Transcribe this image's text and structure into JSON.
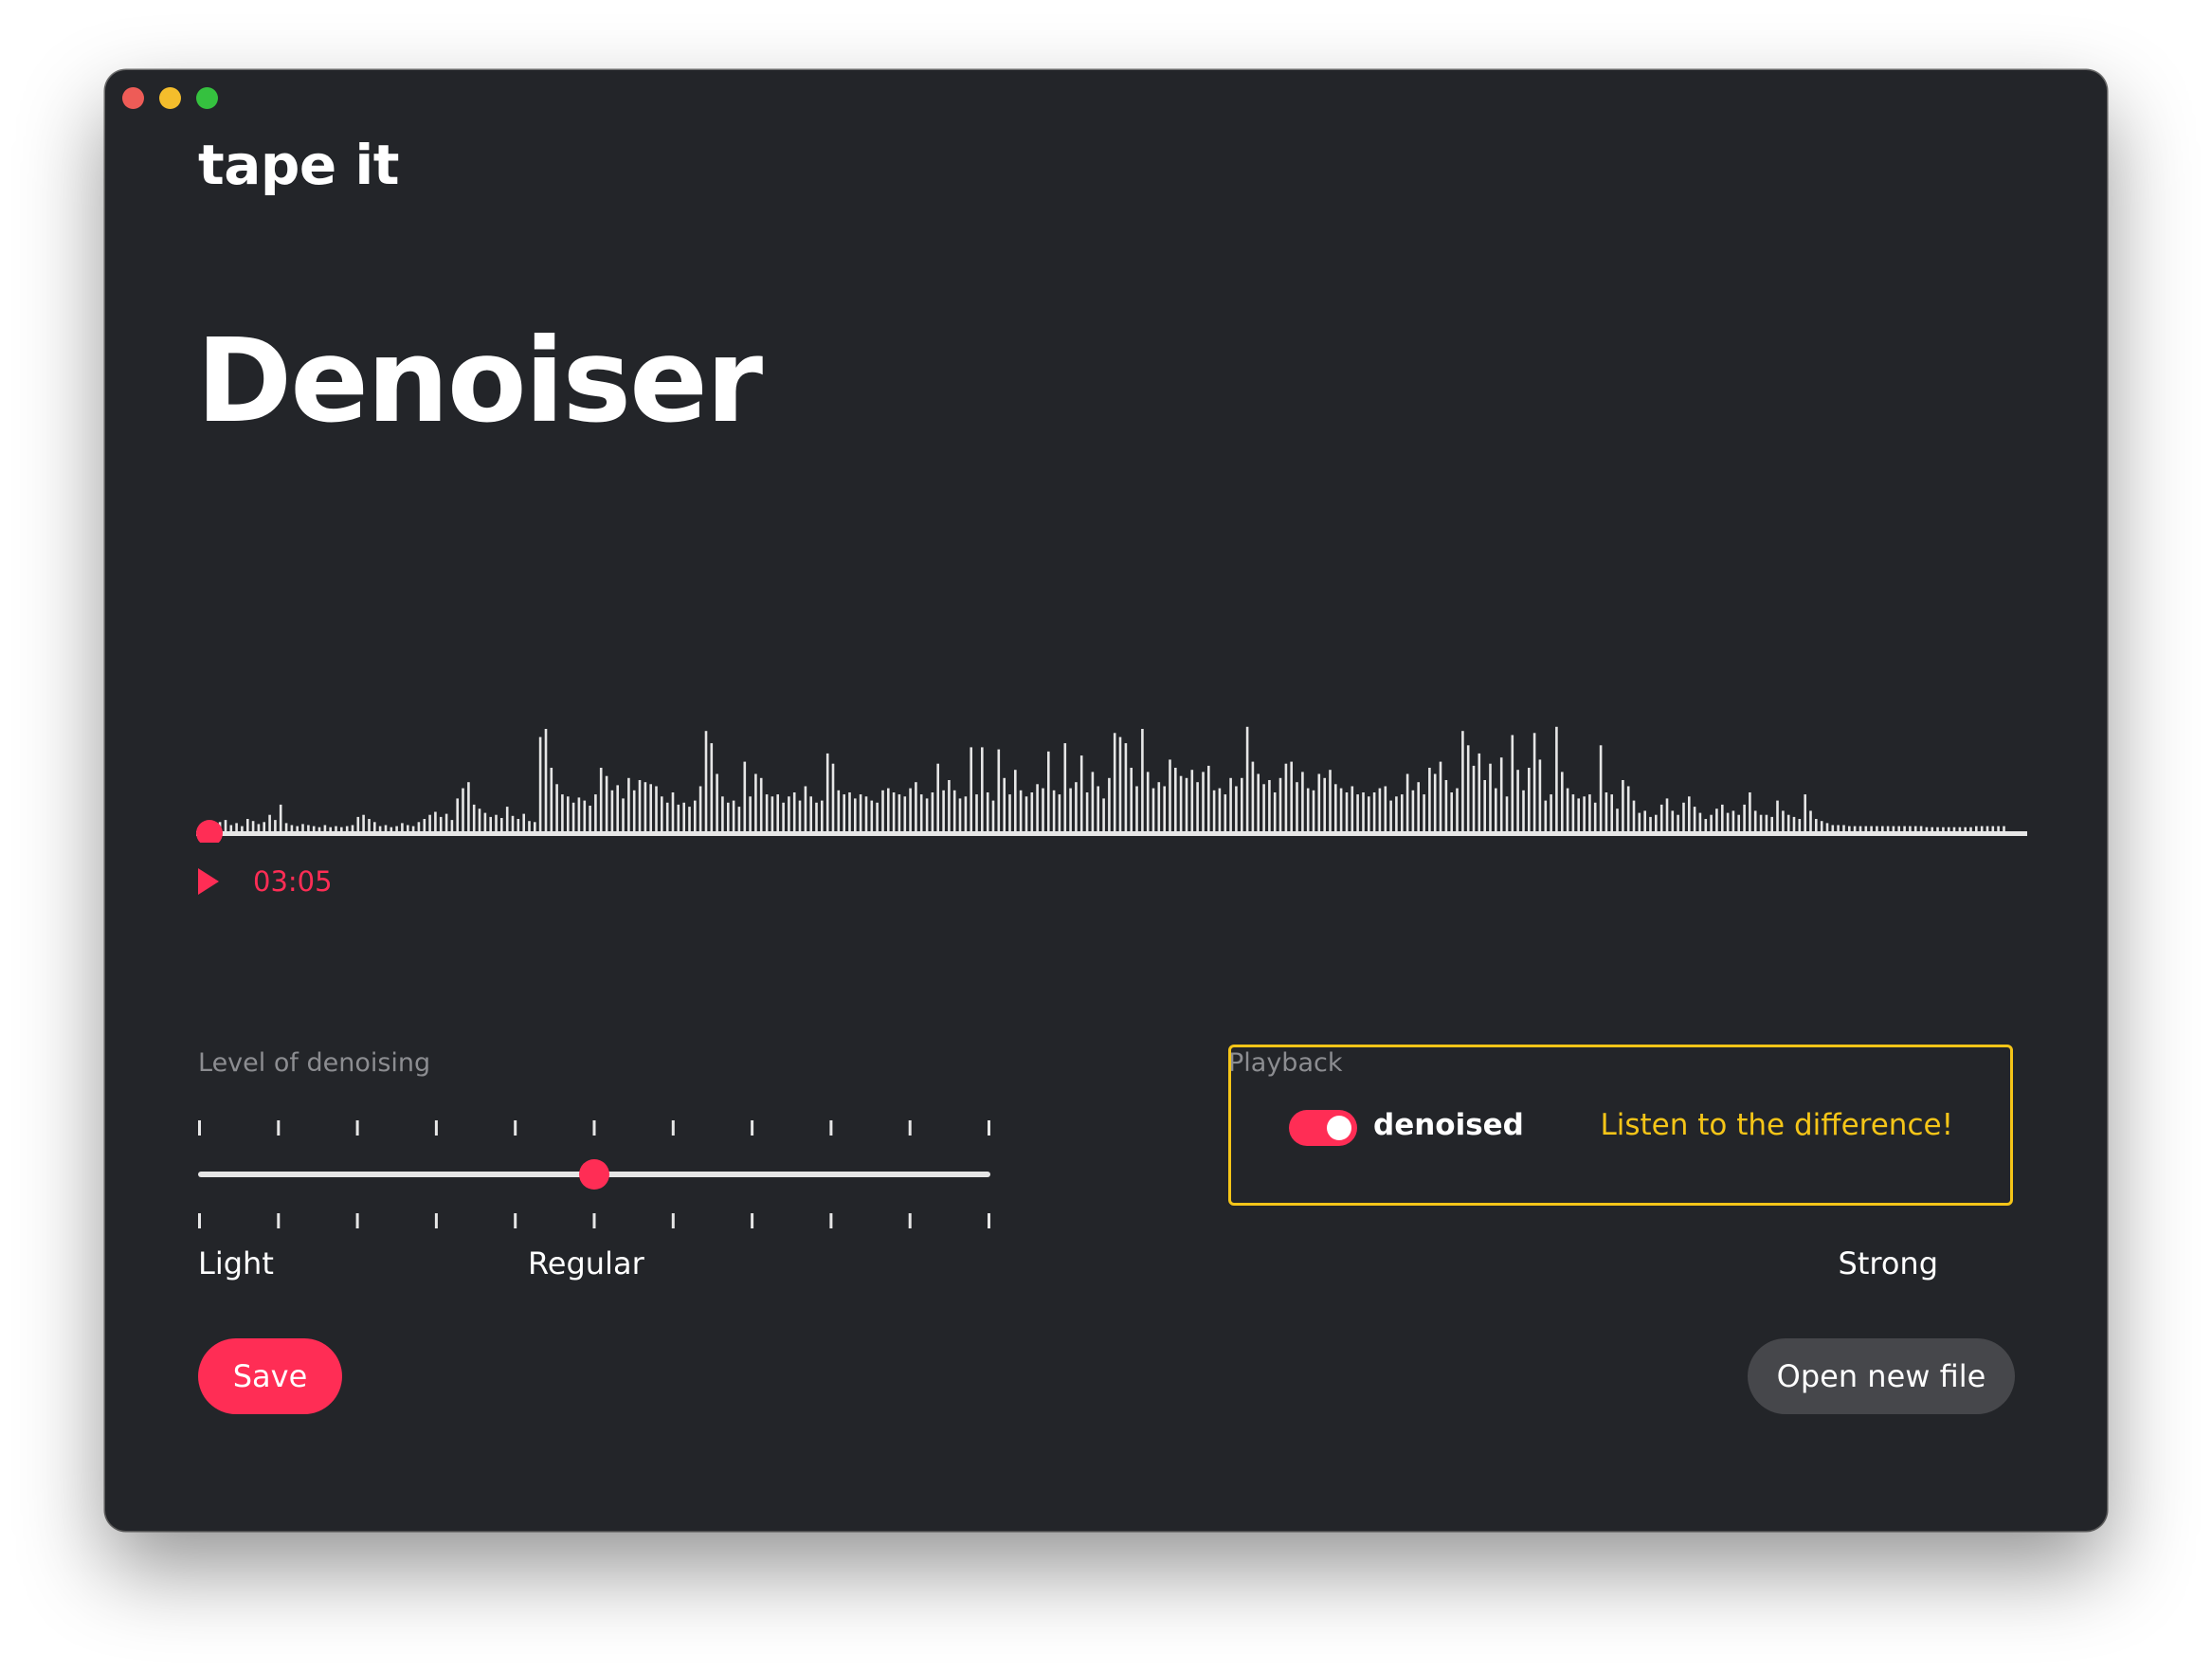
{
  "app": {
    "name": "tape it"
  },
  "page": {
    "title": "Denoiser"
  },
  "player": {
    "time": "03:05",
    "position": 0.0
  },
  "denoise": {
    "label": "Level of denoising",
    "levels": [
      "Light",
      "Regular",
      "Strong"
    ],
    "tick_count": 11,
    "value": 0.5
  },
  "playback": {
    "label": "Playback",
    "toggle_label": "denoised",
    "toggle_on": true,
    "hint": "Listen to the difference!"
  },
  "actions": {
    "save": "Save",
    "open": "Open new file"
  },
  "colors": {
    "background": "#232529",
    "accent": "#ff2d55",
    "highlight": "#f5c518",
    "waveform": "#e6e6e6"
  },
  "icons": [
    "play-icon"
  ],
  "waveform_peaks": [
    0.05,
    0.09,
    0.11,
    0.06,
    0.08,
    0.05,
    0.12,
    0.1,
    0.07,
    0.09,
    0.16,
    0.11,
    0.26,
    0.08,
    0.06,
    0.05,
    0.07,
    0.06,
    0.05,
    0.04,
    0.06,
    0.04,
    0.05,
    0.04,
    0.05,
    0.06,
    0.14,
    0.16,
    0.12,
    0.09,
    0.05,
    0.06,
    0.04,
    0.05,
    0.08,
    0.06,
    0.05,
    0.09,
    0.12,
    0.16,
    0.19,
    0.14,
    0.17,
    0.11,
    0.32,
    0.42,
    0.48,
    0.26,
    0.22,
    0.18,
    0.14,
    0.16,
    0.13,
    0.24,
    0.15,
    0.12,
    0.17,
    0.1,
    0.09,
    0.92,
    1.0,
    0.62,
    0.46,
    0.36,
    0.34,
    0.28,
    0.33,
    0.3,
    0.25,
    0.36,
    0.62,
    0.54,
    0.4,
    0.45,
    0.32,
    0.52,
    0.4,
    0.5,
    0.48,
    0.46,
    0.44,
    0.34,
    0.28,
    0.38,
    0.26,
    0.28,
    0.24,
    0.3,
    0.44,
    0.98,
    0.86,
    0.56,
    0.34,
    0.28,
    0.3,
    0.24,
    0.68,
    0.34,
    0.56,
    0.52,
    0.36,
    0.34,
    0.36,
    0.28,
    0.34,
    0.38,
    0.3,
    0.44,
    0.34,
    0.28,
    0.3,
    0.76,
    0.66,
    0.4,
    0.36,
    0.38,
    0.32,
    0.36,
    0.34,
    0.3,
    0.28,
    0.4,
    0.42,
    0.38,
    0.36,
    0.34,
    0.42,
    0.48,
    0.36,
    0.32,
    0.38,
    0.66,
    0.4,
    0.5,
    0.4,
    0.32,
    0.34,
    0.82,
    0.36,
    0.82,
    0.38,
    0.3,
    0.8,
    0.52,
    0.36,
    0.6,
    0.4,
    0.34,
    0.38,
    0.46,
    0.42,
    0.78,
    0.4,
    0.36,
    0.86,
    0.42,
    0.48,
    0.74,
    0.38,
    0.58,
    0.44,
    0.32,
    0.52,
    0.96,
    0.92,
    0.86,
    0.62,
    0.44,
    1.0,
    0.58,
    0.42,
    0.48,
    0.44,
    0.7,
    0.62,
    0.54,
    0.52,
    0.6,
    0.48,
    0.58,
    0.64,
    0.4,
    0.42,
    0.36,
    0.52,
    0.44,
    0.52,
    1.02,
    0.68,
    0.56,
    0.46,
    0.5,
    0.38,
    0.52,
    0.66,
    0.68,
    0.48,
    0.58,
    0.42,
    0.4,
    0.56,
    0.52,
    0.6,
    0.46,
    0.42,
    0.38,
    0.44,
    0.36,
    0.38,
    0.34,
    0.38,
    0.42,
    0.44,
    0.3,
    0.34,
    0.36,
    0.56,
    0.4,
    0.48,
    0.36,
    0.62,
    0.56,
    0.68,
    0.5,
    0.38,
    0.42,
    0.98,
    0.84,
    0.64,
    0.76,
    0.5,
    0.66,
    0.42,
    0.72,
    0.34,
    0.94,
    0.6,
    0.4,
    0.62,
    0.96,
    0.7,
    0.3,
    0.36,
    1.02,
    0.58,
    0.42,
    0.36,
    0.32,
    0.34,
    0.36,
    0.28,
    0.84,
    0.38,
    0.36,
    0.22,
    0.5,
    0.44,
    0.3,
    0.18,
    0.2,
    0.14,
    0.16,
    0.26,
    0.32,
    0.2,
    0.16,
    0.28,
    0.34,
    0.24,
    0.18,
    0.12,
    0.16,
    0.22,
    0.26,
    0.18,
    0.2,
    0.16,
    0.26,
    0.38,
    0.2,
    0.16,
    0.16,
    0.14,
    0.3,
    0.2,
    0.16,
    0.14,
    0.12,
    0.36,
    0.2,
    0.12,
    0.1,
    0.08,
    0.06,
    0.06,
    0.06,
    0.05,
    0.05,
    0.05,
    0.05,
    0.05,
    0.05,
    0.05,
    0.05,
    0.05,
    0.05,
    0.05,
    0.05,
    0.05,
    0.05,
    0.04,
    0.04,
    0.04,
    0.04,
    0.04,
    0.04,
    0.04,
    0.04,
    0.04,
    0.05,
    0.05,
    0.05,
    0.05,
    0.05,
    0.05
  ]
}
